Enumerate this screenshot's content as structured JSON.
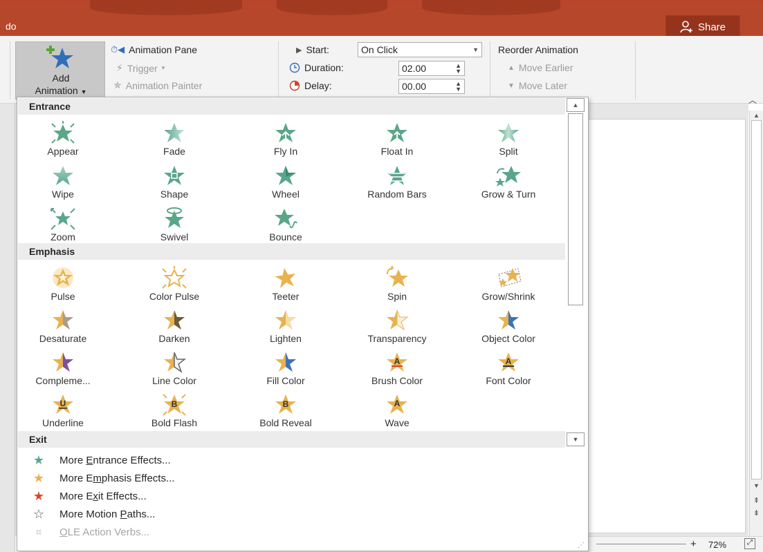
{
  "titlebar": {
    "left_text": "do",
    "share_label": "Share"
  },
  "ribbon": {
    "add_animation": {
      "line1": "Add",
      "line2": "Animation"
    },
    "animation_pane": "Animation Pane",
    "trigger": "Trigger",
    "animation_painter": "Animation Painter",
    "start": {
      "label": "Start:",
      "value": "On Click"
    },
    "duration": {
      "label": "Duration:",
      "value": "02.00"
    },
    "delay": {
      "label": "Delay:",
      "value": "00.00"
    },
    "reorder": {
      "title": "Reorder Animation",
      "move_earlier": "Move Earlier",
      "move_later": "Move Later"
    }
  },
  "gallery": {
    "sections": {
      "entrance": "Entrance",
      "emphasis": "Emphasis",
      "exit": "Exit"
    },
    "entrance": [
      {
        "label": "Appear",
        "icon": "appear-icon"
      },
      {
        "label": "Fade",
        "icon": "fade-icon"
      },
      {
        "label": "Fly In",
        "icon": "fly-in-icon"
      },
      {
        "label": "Float In",
        "icon": "float-in-icon"
      },
      {
        "label": "Split",
        "icon": "split-icon"
      },
      {
        "label": "Wipe",
        "icon": "wipe-icon"
      },
      {
        "label": "Shape",
        "icon": "shape-icon"
      },
      {
        "label": "Wheel",
        "icon": "wheel-icon"
      },
      {
        "label": "Random Bars",
        "icon": "random-bars-icon"
      },
      {
        "label": "Grow & Turn",
        "icon": "grow-turn-icon"
      },
      {
        "label": "Zoom",
        "icon": "zoom-icon"
      },
      {
        "label": "Swivel",
        "icon": "swivel-icon"
      },
      {
        "label": "Bounce",
        "icon": "bounce-icon"
      }
    ],
    "emphasis": [
      {
        "label": "Pulse",
        "icon": "pulse-icon"
      },
      {
        "label": "Color Pulse",
        "icon": "color-pulse-icon"
      },
      {
        "label": "Teeter",
        "icon": "teeter-icon"
      },
      {
        "label": "Spin",
        "icon": "spin-icon"
      },
      {
        "label": "Grow/Shrink",
        "icon": "grow-shrink-icon"
      },
      {
        "label": "Desaturate",
        "icon": "desaturate-icon"
      },
      {
        "label": "Darken",
        "icon": "darken-icon"
      },
      {
        "label": "Lighten",
        "icon": "lighten-icon"
      },
      {
        "label": "Transparency",
        "icon": "transparency-icon"
      },
      {
        "label": "Object Color",
        "icon": "object-color-icon"
      },
      {
        "label": "Compleme...",
        "icon": "complementary-color-icon"
      },
      {
        "label": "Line Color",
        "icon": "line-color-icon"
      },
      {
        "label": "Fill Color",
        "icon": "fill-color-icon"
      },
      {
        "label": "Brush Color",
        "icon": "brush-color-icon"
      },
      {
        "label": "Font Color",
        "icon": "font-color-icon"
      },
      {
        "label": "Underline",
        "icon": "underline-icon"
      },
      {
        "label": "Bold Flash",
        "icon": "bold-flash-icon"
      },
      {
        "label": "Bold Reveal",
        "icon": "bold-reveal-icon"
      },
      {
        "label": "Wave",
        "icon": "wave-icon"
      }
    ],
    "more": {
      "entrance": {
        "pre": "More ",
        "key": "E",
        "post": "ntrance Effects..."
      },
      "emphasis": {
        "pre": "More E",
        "key": "m",
        "post": "phasis Effects..."
      },
      "exit": {
        "pre": "More E",
        "key": "x",
        "post": "it Effects..."
      },
      "motion": {
        "pre": "More Motion ",
        "key": "P",
        "post": "aths..."
      },
      "ole": {
        "pre": "",
        "key": "O",
        "post": "LE Action Verbs..."
      }
    }
  },
  "statusbar": {
    "zoom": "72%"
  },
  "colors": {
    "accent": "#b7472a",
    "entrance_star": "#5aa689",
    "emphasis_star": "#e8b24f",
    "exit_star": "#d9452b"
  }
}
